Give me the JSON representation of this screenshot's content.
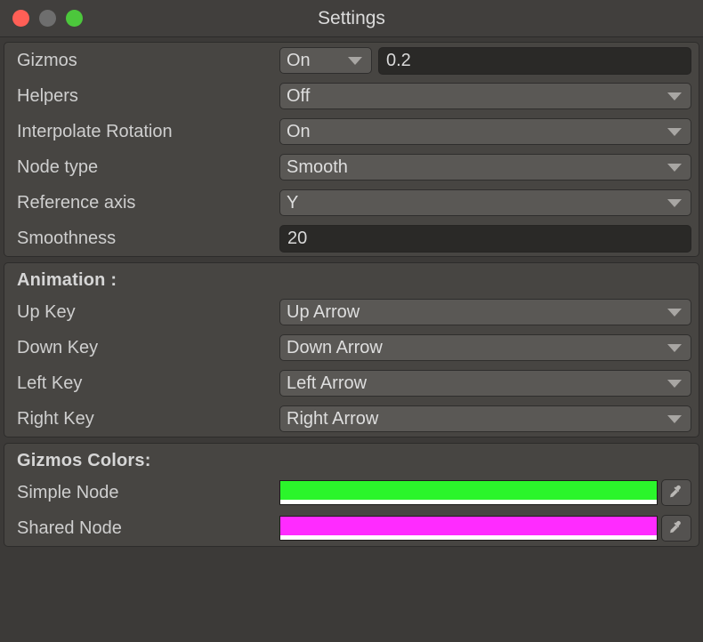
{
  "window": {
    "title": "Settings",
    "controls": [
      {
        "name": "close",
        "color": "#ff5f56"
      },
      {
        "name": "minimize",
        "color": "#6e6e6e"
      },
      {
        "name": "maximize",
        "color": "#4cc73c"
      }
    ]
  },
  "general": {
    "gizmos": {
      "label": "Gizmos",
      "toggle_value": "On",
      "size_value": "0.2"
    },
    "helpers": {
      "label": "Helpers",
      "value": "Off"
    },
    "interpolate_rotation": {
      "label": "Interpolate Rotation",
      "value": "On"
    },
    "node_type": {
      "label": "Node type",
      "value": "Smooth"
    },
    "reference_axis": {
      "label": "Reference axis",
      "value": "Y"
    },
    "smoothness": {
      "label": "Smoothness",
      "value": "20"
    }
  },
  "animation": {
    "title": "Animation :",
    "up_key": {
      "label": "Up Key",
      "value": "Up Arrow"
    },
    "down_key": {
      "label": "Down Key",
      "value": "Down Arrow"
    },
    "left_key": {
      "label": "Left Key",
      "value": "Left Arrow"
    },
    "right_key": {
      "label": "Right Key",
      "value": "Right Arrow"
    }
  },
  "gizmos_colors": {
    "title": "Gizmos Colors:",
    "simple_node": {
      "label": "Simple Node",
      "color": "#2bf52b",
      "alpha_color": "#ffffff"
    },
    "shared_node": {
      "label": "Shared Node",
      "color": "#ff2bff",
      "alpha_color": "#ffffff"
    }
  }
}
